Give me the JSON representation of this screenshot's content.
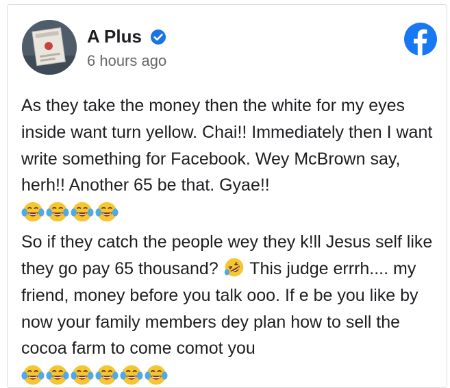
{
  "post": {
    "author": "A Plus",
    "timestamp": "6 hours ago",
    "paragraph1": "As they take the money then the white for my eyes inside want turn yellow. Chai!! Immediately then I want write something for Facebook. Wey McBrown say, herh!! Another 65 be that. Gyae!!",
    "paragraph1_emojis": [
      "tears-of-joy",
      "tears-of-joy",
      "tears-of-joy",
      "tears-of-joy"
    ],
    "paragraph2_part1": "So if they catch the people wey they k!ll Jesus self like they go pay 65 thousand?",
    "paragraph2_inline_emoji": "rolling-on-floor-laughing",
    "paragraph2_part2": "This judge errrh.... my friend, money before you talk ooo. If e be you like by now your family members dey plan how to sell the cocoa farm to come comot you",
    "paragraph2_emojis": [
      "tears-of-joy",
      "tears-of-joy",
      "tears-of-joy",
      "tears-of-joy",
      "tears-of-joy",
      "tears-of-joy"
    ]
  },
  "colors": {
    "facebook_blue": "#1877f2",
    "verified_blue": "#1b74e4",
    "text": "#1c1e21",
    "muted": "#65676b"
  }
}
